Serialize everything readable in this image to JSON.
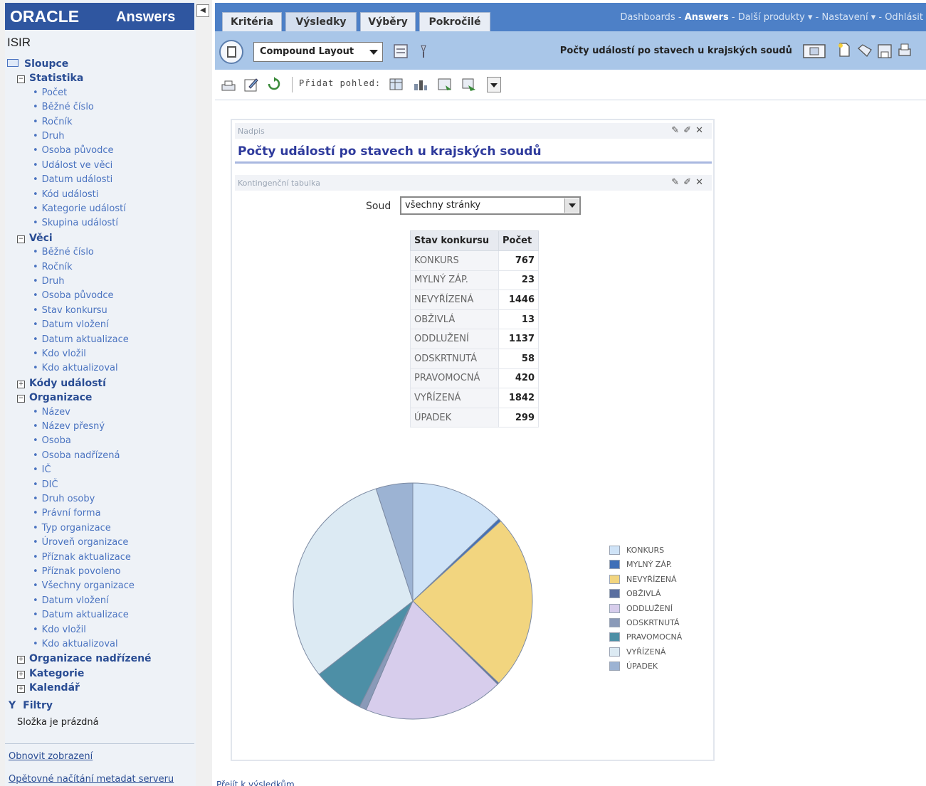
{
  "branding": {
    "product": "ORACLE",
    "module": "Answers"
  },
  "left_panel": {
    "subject_area": "ISIR",
    "columns_header": "Sloupce",
    "folders": [
      {
        "name": "Statistika",
        "expanded": true,
        "columns": [
          "Počet",
          "Běžné číslo",
          "Ročník",
          "Druh",
          "Osoba původce",
          "Událost ve věci",
          "Datum události",
          "Kód události",
          "Kategorie událostí",
          "Skupina událostí"
        ]
      },
      {
        "name": "Věci",
        "expanded": true,
        "columns": [
          "Běžné číslo",
          "Ročník",
          "Druh",
          "Osoba původce",
          "Stav konkursu",
          "Datum vložení",
          "Datum aktualizace",
          "Kdo vložil",
          "Kdo aktualizoval"
        ]
      },
      {
        "name": "Kódy událostí",
        "expanded": false,
        "columns": []
      },
      {
        "name": "Organizace",
        "expanded": true,
        "columns": [
          "Název",
          "Název přesný",
          "Osoba",
          "Osoba nadřízená",
          "IČ",
          "DIČ",
          "Druh osoby",
          "Právní forma",
          "Typ organizace",
          "Úroveň organizace",
          "Příznak aktualizace",
          "Příznak povoleno",
          "Všechny organizace",
          "Datum vložení",
          "Datum aktualizace",
          "Kdo vložil",
          "Kdo aktualizoval"
        ]
      },
      {
        "name": "Organizace nadřízené",
        "expanded": false,
        "columns": []
      },
      {
        "name": "Kategorie",
        "expanded": false,
        "columns": []
      },
      {
        "name": "Kalendář",
        "expanded": false,
        "columns": []
      }
    ],
    "filters_header": "Filtry",
    "filters_empty": "Složka je prázdná",
    "links": {
      "refresh": "Obnovit zobrazení",
      "reload": "Opětovné načítání metadat serveru"
    }
  },
  "tabs": [
    {
      "label": "Kritéria",
      "active": false
    },
    {
      "label": "Výsledky",
      "active": true
    },
    {
      "label": "Výběry",
      "active": false
    },
    {
      "label": "Pokročilé",
      "active": false
    }
  ],
  "global_nav": {
    "dashboards": "Dashboards",
    "answers": "Answers",
    "more_products": "Další produkty",
    "settings": "Nastavení",
    "logout": "Odhlásit"
  },
  "toolbar": {
    "layout_select": "Compound Layout",
    "report_title": "Počty událostí po stavech u krajských soudů",
    "add_view_label": "Přidat pohled:"
  },
  "compound": {
    "title_view": {
      "header": "Nadpis",
      "title": "Počty událostí po stavech u krajských soudů"
    },
    "pivot_view": {
      "header": "Kontingenční tabulka",
      "prompt_label": "Soud",
      "prompt_value": "všechny stránky",
      "columns": [
        "Stav konkursu",
        "Počet"
      ],
      "rows": [
        {
          "stav": "KONKURS",
          "pocet": "767"
        },
        {
          "stav": "MYLNÝ ZÁP.",
          "pocet": "23"
        },
        {
          "stav": "NEVYŘÍZENÁ",
          "pocet": "1446"
        },
        {
          "stav": "OBŽIVLÁ",
          "pocet": "13"
        },
        {
          "stav": "ODDLUŽENÍ",
          "pocet": "1137"
        },
        {
          "stav": "ODSKRTNUTÁ",
          "pocet": "58"
        },
        {
          "stav": "PRAVOMOCNÁ",
          "pocet": "420"
        },
        {
          "stav": "VYŘÍZENÁ",
          "pocet": "1842"
        },
        {
          "stav": "ÚPADEK",
          "pocet": "299"
        }
      ]
    }
  },
  "chart_data": {
    "type": "pie",
    "categories": [
      "KONKURS",
      "MYLNÝ ZÁP.",
      "NEVYŘÍZENÁ",
      "OBŽIVLÁ",
      "ODDLUŽENÍ",
      "ODSKRTNUTÁ",
      "PRAVOMOCNÁ",
      "VYŘÍZENÁ",
      "ÚPADEK"
    ],
    "values": [
      767,
      23,
      1446,
      13,
      1137,
      58,
      420,
      1842,
      299
    ],
    "colors": [
      "#cfe3f7",
      "#3f6fb8",
      "#f2d57f",
      "#5a6fa0",
      "#d7cdec",
      "#8a9ab8",
      "#4d8fa6",
      "#dceaf3",
      "#9cb3d3"
    ],
    "legend": "right"
  },
  "bottom_link": "Přejít k výsledkům"
}
